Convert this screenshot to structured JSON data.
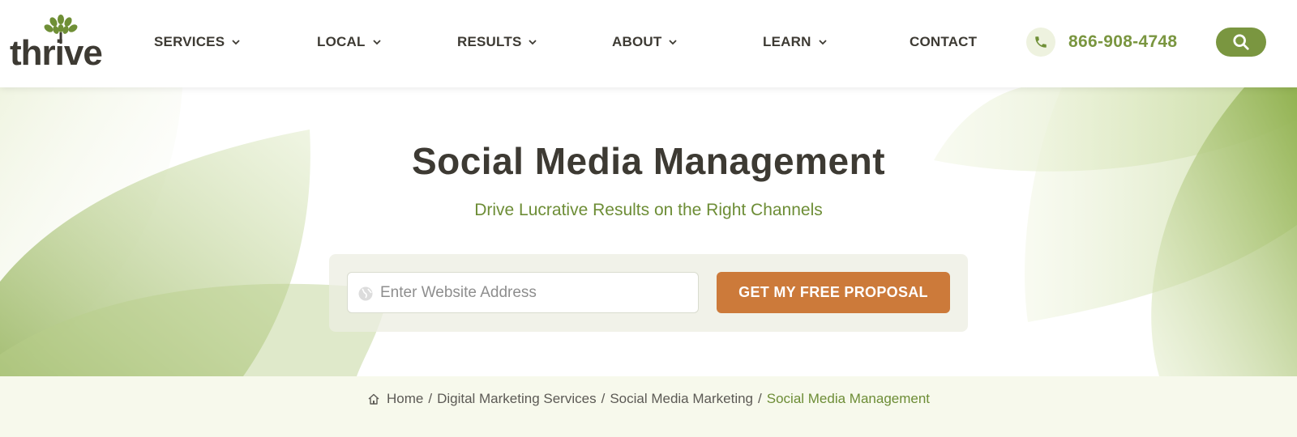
{
  "brand": {
    "logo_text": "thrive",
    "accent": "#7a9640",
    "cta_color": "#cc7a3a"
  },
  "nav": {
    "items": [
      {
        "label": "SERVICES",
        "has_dropdown": true
      },
      {
        "label": "LOCAL",
        "has_dropdown": true
      },
      {
        "label": "RESULTS",
        "has_dropdown": true
      },
      {
        "label": "ABOUT",
        "has_dropdown": true
      },
      {
        "label": "LEARN",
        "has_dropdown": true
      },
      {
        "label": "CONTACT",
        "has_dropdown": false
      }
    ],
    "phone": "866-908-4748",
    "phone_icon": "phone-icon",
    "search_icon": "search-icon"
  },
  "hero": {
    "title": "Social Media Management",
    "subtitle": "Drive Lucrative Results on the Right Channels",
    "form": {
      "input_placeholder": "Enter Website Address",
      "input_value": "",
      "input_icon": "globe-icon",
      "cta_label": "GET MY FREE PROPOSAL"
    }
  },
  "breadcrumb": {
    "home_icon": "home-icon",
    "items": [
      "Home",
      "Digital Marketing Services",
      "Social Media Marketing"
    ],
    "current": "Social Media Management",
    "separator": "/"
  }
}
